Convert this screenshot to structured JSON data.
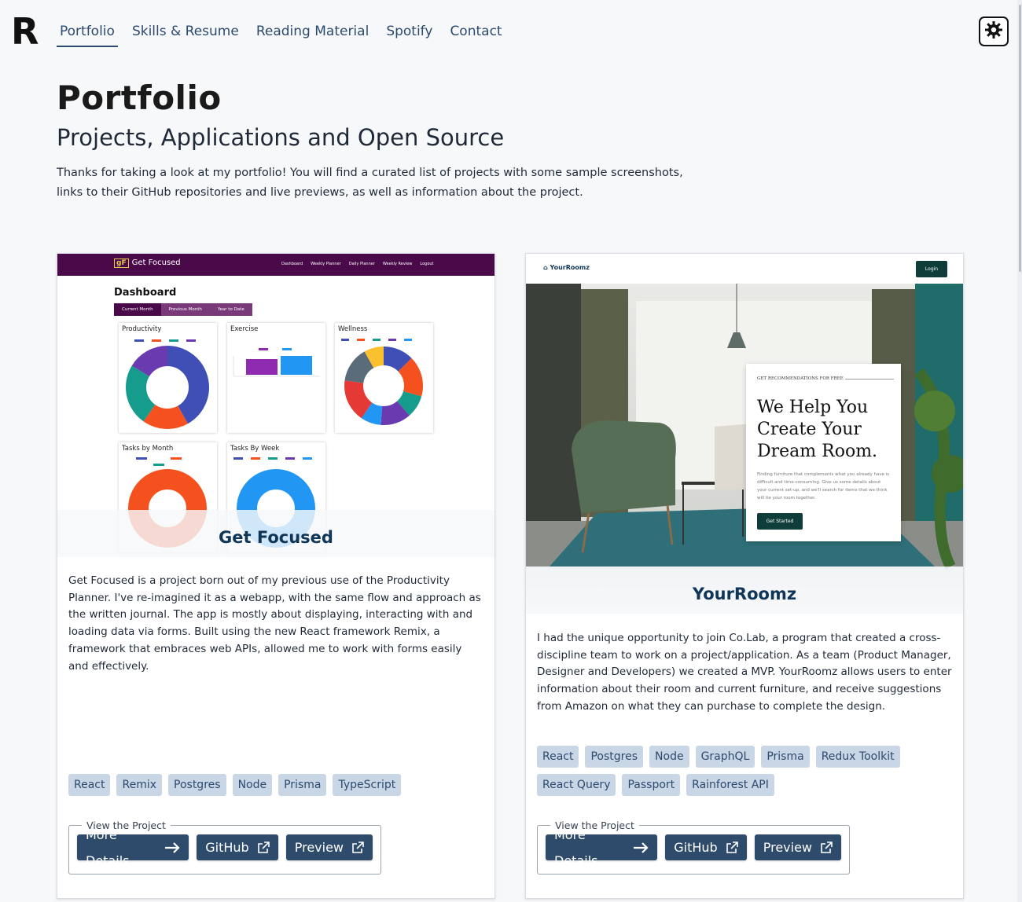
{
  "logo": "R",
  "nav": {
    "items": [
      {
        "label": "Portfolio"
      },
      {
        "label": "Skills & Resume"
      },
      {
        "label": "Reading Material"
      },
      {
        "label": "Spotify"
      },
      {
        "label": "Contact"
      }
    ]
  },
  "theme_toggle_icon": "sun-gear-icon",
  "page": {
    "title": "Portfolio",
    "subtitle": "Projects, Applications and Open Source",
    "intro": "Thanks for taking a look at my portfolio! You will find a curated list of projects with some sample screenshots, links to their GitHub repositories and live previews, as well as information about the project."
  },
  "colors": {
    "accent": "#2e4b6b",
    "tag_bg": "#c9d6e6",
    "title": "#0f3557"
  },
  "projects": [
    {
      "title": "Get Focused",
      "description": "Get Focused is a project born out of my previous use of the Productivity Planner. I've re-imagined it as a webapp, with the same flow and approach as the written journal. The app is mostly about displaying, interacting with and loading data via forms. Built using the new React framework Remix, a framework that embraces web APIs, allowed me to work with forms easily and effectively.",
      "tags": [
        "React",
        "Remix",
        "Postgres",
        "Node",
        "Prisma",
        "TypeScript"
      ],
      "fieldset_legend": "View the Project",
      "buttons": {
        "details": "More Details",
        "github": "GitHub",
        "preview": "Preview"
      },
      "screenshot": {
        "brand_mark": "gF",
        "brand": "Get Focused",
        "links": [
          "Dashboard",
          "Weekly Planner",
          "Daily Planner",
          "Weekly Review",
          "Logout"
        ],
        "heading": "Dashboard",
        "tabs": [
          "Current Month",
          "Previous Month",
          "Year to Date"
        ],
        "panels": [
          "Productivity",
          "Exercise",
          "Wellness",
          "Tasks by Month",
          "Tasks By Week"
        ]
      }
    },
    {
      "title": "YourRoomz",
      "description": "I had the unique opportunity to join Co.Lab, a program that created a cross-discipline team to work on a project/application. As a team (Product Manager, Designer and Developers) we created a MVP. YourRoomz allows users to enter information about their room and current furniture, and receive suggestions from Amazon on what they can purchase to complete the design.",
      "tags": [
        "React",
        "Postgres",
        "Node",
        "GraphQL",
        "Prisma",
        "Redux Toolkit",
        "React Query",
        "Passport",
        "Rainforest API"
      ],
      "fieldset_legend": "View the Project",
      "buttons": {
        "details": "More Details",
        "github": "GitHub",
        "preview": "Preview"
      },
      "screenshot": {
        "brand": "YourRoomz",
        "login": "Login",
        "kicker": "GET RECOMMENDATIONS FOR FREE",
        "headline": "We Help You Create Your Dream Room.",
        "paragraph": "Finding furniture that complements what you already have is difficult and time-consuming. Give us some details about your current set-up, and we'll search for items that we think will tie your room together.",
        "cta": "Get Started"
      }
    }
  ]
}
